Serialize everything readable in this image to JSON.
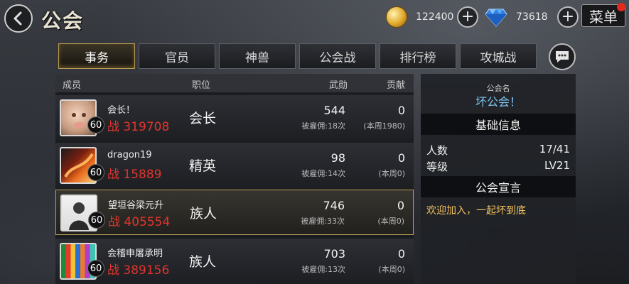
{
  "header": {
    "title": "公会",
    "gold": "122400",
    "gems": "73618",
    "menu_label": "菜单",
    "back_icon": "back-arrow-icon",
    "plus_icon": "plus-icon"
  },
  "tabs": [
    {
      "label": "事务",
      "active": true
    },
    {
      "label": "官员",
      "active": false
    },
    {
      "label": "神兽",
      "active": false
    },
    {
      "label": "公会战",
      "active": false
    },
    {
      "label": "排行榜",
      "active": false
    },
    {
      "label": "攻城战",
      "active": false
    }
  ],
  "list": {
    "columns": {
      "member": "成员",
      "position": "职位",
      "honor": "武勋",
      "contribution": "贡献"
    },
    "rows": [
      {
        "level": "60",
        "name": "会长！",
        "power": "战 319708",
        "position": "会长",
        "honor": "544",
        "hired": "被雇佣:18次",
        "contribution": "0",
        "weekly": "(本周1980)"
      },
      {
        "level": "60",
        "name": "dragon19",
        "power": "战 15889",
        "position": "精英",
        "honor": "98",
        "hired": "被雇佣:14次",
        "contribution": "0",
        "weekly": "(本周0)"
      },
      {
        "level": "60",
        "name": "望垣谷梁元升",
        "power": "战 405554",
        "position": "族人",
        "honor": "746",
        "hired": "被雇佣:33次",
        "contribution": "0",
        "weekly": "(本周0)"
      },
      {
        "level": "60",
        "name": "会稽申屠承明",
        "power": "战 389156",
        "position": "族人",
        "honor": "703",
        "hired": "被雇佣:13次",
        "contribution": "0",
        "weekly": "(本周0)"
      }
    ]
  },
  "info": {
    "guild_name_label": "公会名",
    "guild_name": "坏公会！",
    "basic_info_title": "基础信息",
    "members_label": "人数",
    "members_value": "17/41",
    "level_label": "等级",
    "level_value": "LV21",
    "declaration_title": "公会宣言",
    "declaration": "欢迎加入，一起坏到底"
  },
  "colors": {
    "power_red": "#e2352c",
    "guild_name_blue": "#7ec3ef",
    "declaration_gold": "#f2c15e",
    "active_tab_border": "#b89a52"
  }
}
